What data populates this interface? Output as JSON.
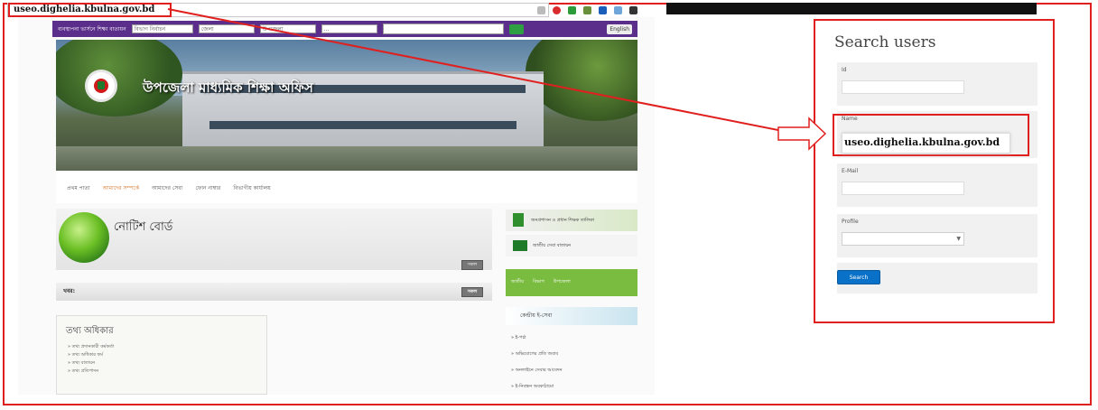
{
  "browser": {
    "url": "useo.dighelia.kbulna.gov.bd"
  },
  "site": {
    "top_nav": {
      "label": "ব্যবস্থাপনা ভার্সনে শিক্ষা বাতায়ন",
      "select_1": "বিভাগ নির্বাচন",
      "select_2": "জেলা",
      "select_3": "উপজেলা",
      "select_4": "...",
      "english_label": "English"
    },
    "office_title": "উপজেলা মাধ্যমিক শিক্ষা অফিস",
    "menu": [
      {
        "label": "প্রথম পাতা",
        "active": false
      },
      {
        "label": "আমাদের সম্পর্কে",
        "active": true
      },
      {
        "label": "আমাদের সেবা",
        "active": false
      },
      {
        "label": "ফোন নাম্বার",
        "active": false
      },
      {
        "label": "বিভাগীয় কার্যালয়",
        "active": false
      }
    ],
    "notice_title": "নোটিশ বোর্ড",
    "more_label": "সকল",
    "news_label": "খবর:",
    "info_box": {
      "title": "তথ্য অধিকার",
      "items": [
        "তথ্য প্রদানকারী কর্মকর্তা",
        "তথ্য অধিকার ফর্ম",
        "তথ্য বাতায়ন",
        "তথ্য প্রতিপাদন"
      ]
    },
    "right_col": {
      "card_1": "জনপ্রশাসন ও প্রধান শিক্ষক তালিকা",
      "card_2": "জাতীয় সেবা বাতায়ন",
      "tabs": [
        "জাতীয়",
        "বিভাগ",
        "উপজেলা"
      ],
      "services_head": "কেন্দ্রীয় ই-সেবা",
      "services": [
        "ই-পর্চা",
        "অভিযোগের প্রতি জবাব",
        "অনলাইনে সেবার আবেদন",
        "ই-নিবন্ধন অবকাঠামো"
      ]
    }
  },
  "search_users": {
    "title": "Search users",
    "fields": {
      "id_label": "Id",
      "name_label": "Name",
      "name_value": "useo.dighelia.kbulna.gov.bd",
      "email_label": "E-Mail",
      "profile_label": "Profile"
    },
    "button_label": "Search"
  },
  "colors": {
    "highlight": "#e0201f",
    "nav_purple": "#5a2e8a",
    "button_blue": "#0a71c9",
    "green": "#79bc3f"
  }
}
